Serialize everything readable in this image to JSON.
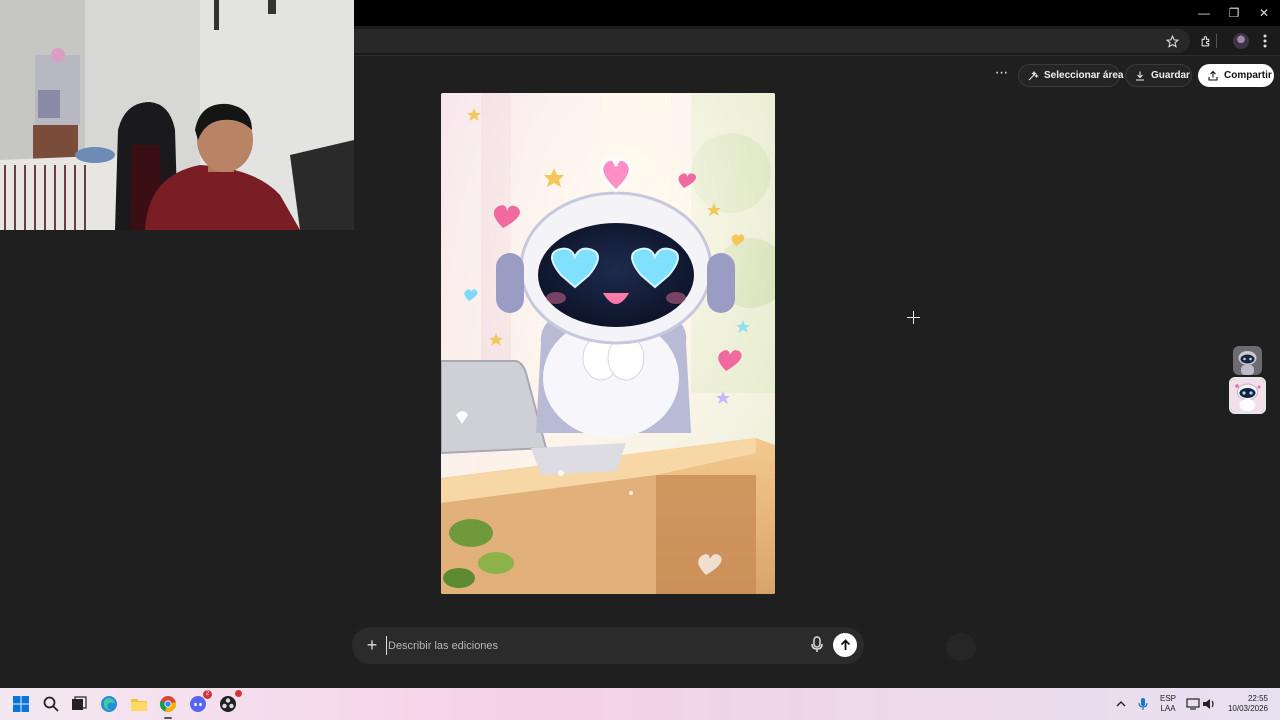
{
  "browser": {
    "window_controls": {
      "minimize": "—",
      "restore": "❐",
      "close": "✕"
    },
    "icons": [
      "star-icon",
      "extensions-icon",
      "profile-avatar",
      "menu-kebab-icon"
    ]
  },
  "toolbar": {
    "more_label": "···",
    "select_area_label": "Seleccionar área",
    "save_label": "Guardar",
    "share_label": "Compartir"
  },
  "prompt": {
    "placeholder": "Describir las ediciones",
    "add_label": "+"
  },
  "taskbar": {
    "language_line1": "ESP",
    "language_line2": "LAA",
    "time": "22:55",
    "date": "10/03/2026",
    "discord_badge": "2",
    "tray_chevron": "^"
  },
  "colors": {
    "background": "#1f1f1f",
    "button_dark": "#242424",
    "button_primary": "#ffffff",
    "prompt_bg": "#2b2b2b",
    "taskbar_pink": "#f6d2e6"
  }
}
